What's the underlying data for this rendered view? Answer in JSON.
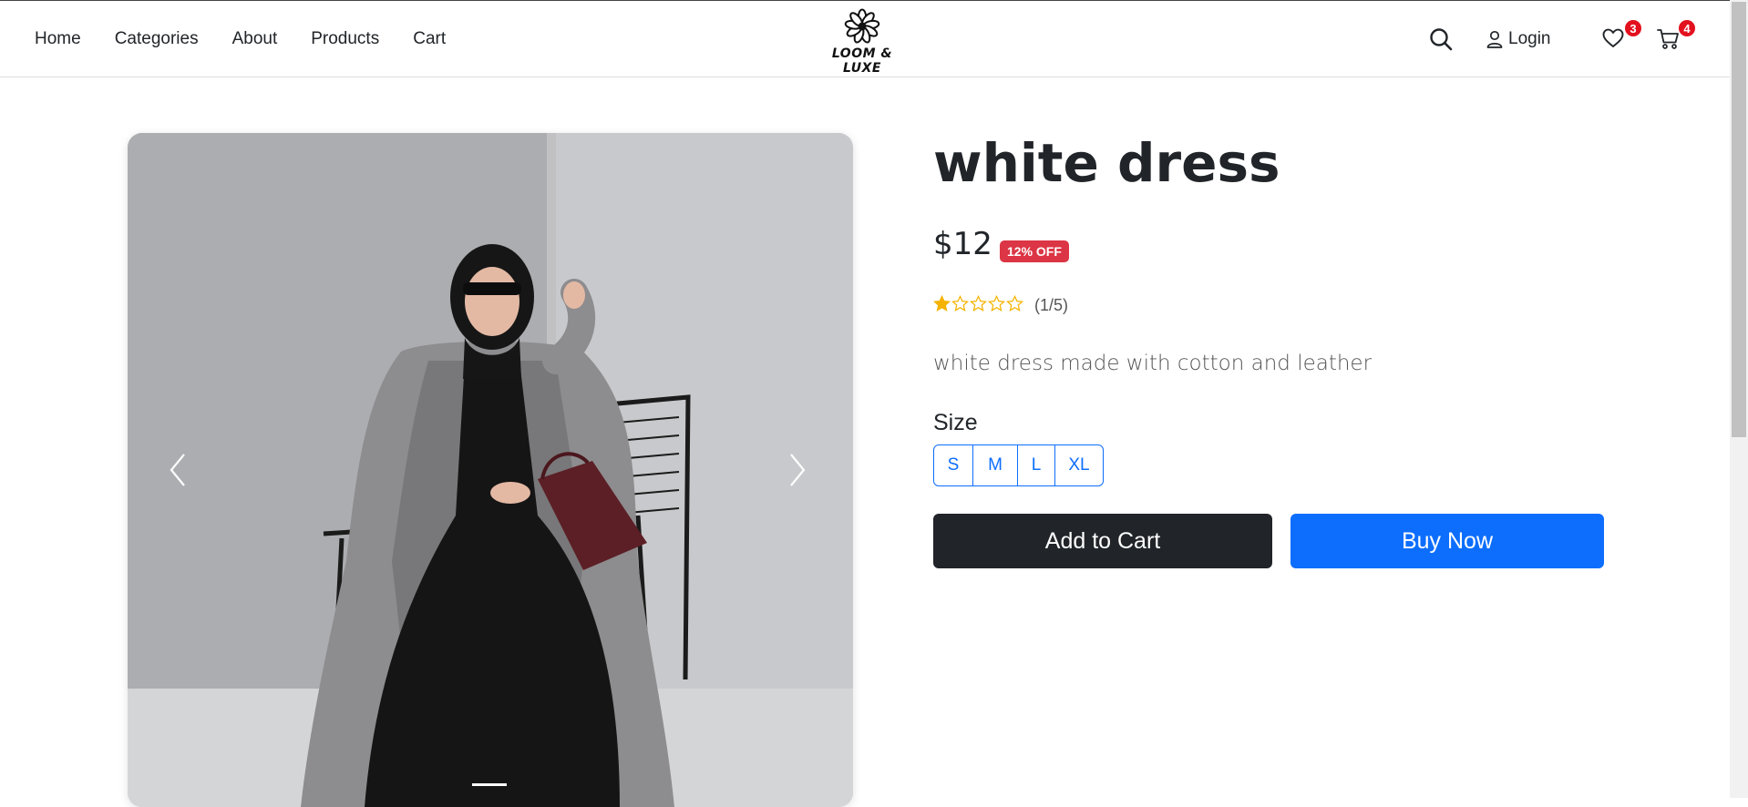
{
  "nav": {
    "links": [
      {
        "label": "Home"
      },
      {
        "label": "Categories"
      },
      {
        "label": "About"
      },
      {
        "label": "Products"
      },
      {
        "label": "Cart"
      }
    ],
    "brand": "LOOM & LUXE",
    "login_label": "Login",
    "wishlist_count": "3",
    "cart_count": "4"
  },
  "product": {
    "title": "white dress",
    "price": "$12",
    "discount": "12% OFF",
    "rating": 1,
    "rating_max": 5,
    "rating_text": "(1/5)",
    "description": "white dress made with cotton and leather",
    "size_label": "Size",
    "sizes": [
      "S",
      "M",
      "L",
      "XL"
    ]
  },
  "actions": {
    "add_to_cart": "Add to Cart",
    "buy_now": "Buy Now"
  },
  "colors": {
    "primary": "#0d6efd",
    "dark": "#212529",
    "danger": "#dc3545",
    "badge": "#e3101e",
    "star": "#f5b301"
  },
  "icons": [
    "flower-logo-icon",
    "search-icon",
    "user-icon",
    "heart-icon",
    "cart-icon",
    "chevron-left-icon",
    "chevron-right-icon",
    "star-icon"
  ]
}
